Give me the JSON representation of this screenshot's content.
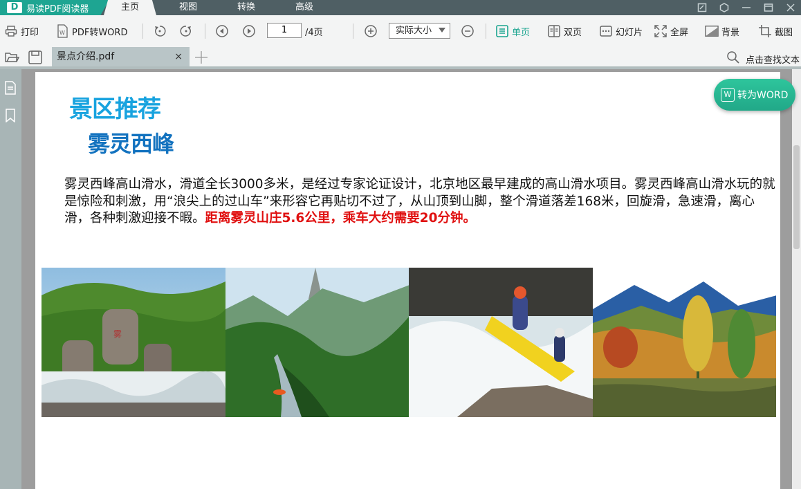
{
  "app": {
    "name": "易读PDF阅读器",
    "menu_tabs": [
      "主页",
      "视图",
      "转换",
      "高级"
    ],
    "active_tab": "主页"
  },
  "toolbar": {
    "print": "打印",
    "pdf_to_word": "PDF转WORD",
    "page_current": "1",
    "page_total": "/4页",
    "zoom": "实际大小",
    "single_page": "单页",
    "double_page": "双页",
    "slideshow": "幻灯片",
    "fullscreen": "全屏",
    "background": "背景",
    "screenshot": "截图"
  },
  "tabs": {
    "document": "景点介绍.pdf",
    "close": "×",
    "search_text": "点击查找文本"
  },
  "float_button": "转为WORD",
  "document": {
    "heading1": "景区推荐",
    "heading2": "雾灵西峰",
    "paragraph": "雾灵西峰高山滑水，滑道全长3000多米，是经过专家论证设计，北京地区最早建成的高山滑水项目。雾灵西峰高山滑水玩的就是惊险和刺激，用“浪尖上的过山车”来形容它再贴切不过了，从山顶到山脚，整个滑道落差168米，回旋滑，急速滑，离心滑，各种刺激迎接不暇。",
    "highlight": "距离雾灵山庄5.6公里，乘车大约需要20分钟。"
  },
  "colors": {
    "brand": "#1ea592",
    "heading1": "#18a3df",
    "heading2": "#1272bf",
    "highlight": "#e01010"
  }
}
